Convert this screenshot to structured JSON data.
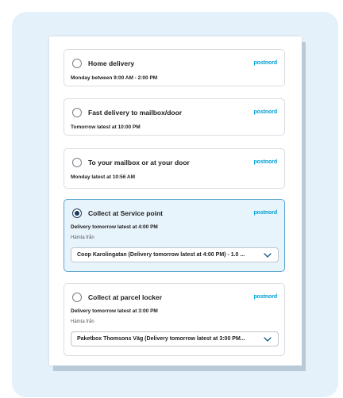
{
  "delivery_options": [
    {
      "title": "Home delivery",
      "carrier": "postnord",
      "detail": "Monday between 9:00 AM - 2:00 PM",
      "selected": false
    },
    {
      "title": "Fast delivery to mailbox/door",
      "carrier": "postnord",
      "detail": "Tomorrow latest at 10:00 PM",
      "selected": false
    },
    {
      "title": "To your mailbox or at your door",
      "carrier": "postnord",
      "detail": "Monday latest at 10:56 AM",
      "selected": false
    },
    {
      "title": "Collect at Service point",
      "carrier": "postnord",
      "detail": "Delivery tomorrow latest at 4:00 PM",
      "selected": true,
      "from_label": "Hämta från",
      "pickup_value": "Coop Karolingatan (Delivery tomorrow latest at 4:00 PM) - 1.0 ..."
    },
    {
      "title": "Collect at parcel locker",
      "carrier": "postnord",
      "detail": "Delivery tomorrow latest at 3:00 PM",
      "selected": false,
      "from_label": "Hämta från",
      "pickup_value": "Paketbox Thomsons Väg (Delivery tomorrow latest at 3:00 PM..."
    }
  ],
  "colors": {
    "brand": "#00a0d6",
    "selected_bg": "#e8f4fb",
    "selected_border": "#5aa6d0",
    "backdrop": "#e4f1fb"
  },
  "icons": {
    "dropdown": "chevron-down-icon"
  }
}
